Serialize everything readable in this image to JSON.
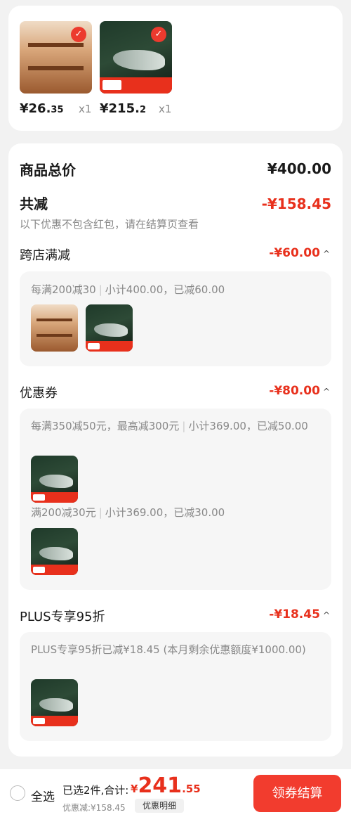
{
  "cart_items": [
    {
      "price_int": "¥26.",
      "price_dec": "35",
      "qty": "x1",
      "image": "bookshelf"
    },
    {
      "price_int": "¥215.",
      "price_dec": "2",
      "qty": "x1",
      "image": "saucony-shoe"
    }
  ],
  "check_icon": "✓",
  "summary": {
    "total_label": "商品总价",
    "total_value": "¥400.00",
    "reduce_label": "共减",
    "reduce_value": "-¥158.45",
    "note": "以下优惠不包含红包，请在结算页查看"
  },
  "sections": {
    "cross_store": {
      "title": "跨店满减",
      "amount": "-¥60.00",
      "rule": "每满200减30",
      "detail": "小计400.00，已减60.00"
    },
    "coupon": {
      "title": "优惠券",
      "amount": "-¥80.00",
      "rule1": "每满350减50元，最高减300元",
      "detail1": "小计369.00，已减50.00",
      "rule2": "满200减30元",
      "detail2": "小计369.00，已减30.00"
    },
    "plus": {
      "title": "PLUS专享95折",
      "amount": "-¥18.45",
      "text": "PLUS专享95折已减¥18.45 (本月剩余优惠额度¥1000.00)"
    }
  },
  "chevron_icon": "^",
  "bottom_bar": {
    "select_all": "全选",
    "selected_text": "已选2件,合计:",
    "currency": "¥",
    "total_int": "241",
    "total_dec": ".55",
    "discount_text": "优惠减:¥158.45",
    "detail_button": "优惠明细",
    "checkout_button": "领券结算"
  },
  "colors": {
    "accent": "#e8301c",
    "button": "#f23c2e",
    "background": "#f2f2f2"
  }
}
